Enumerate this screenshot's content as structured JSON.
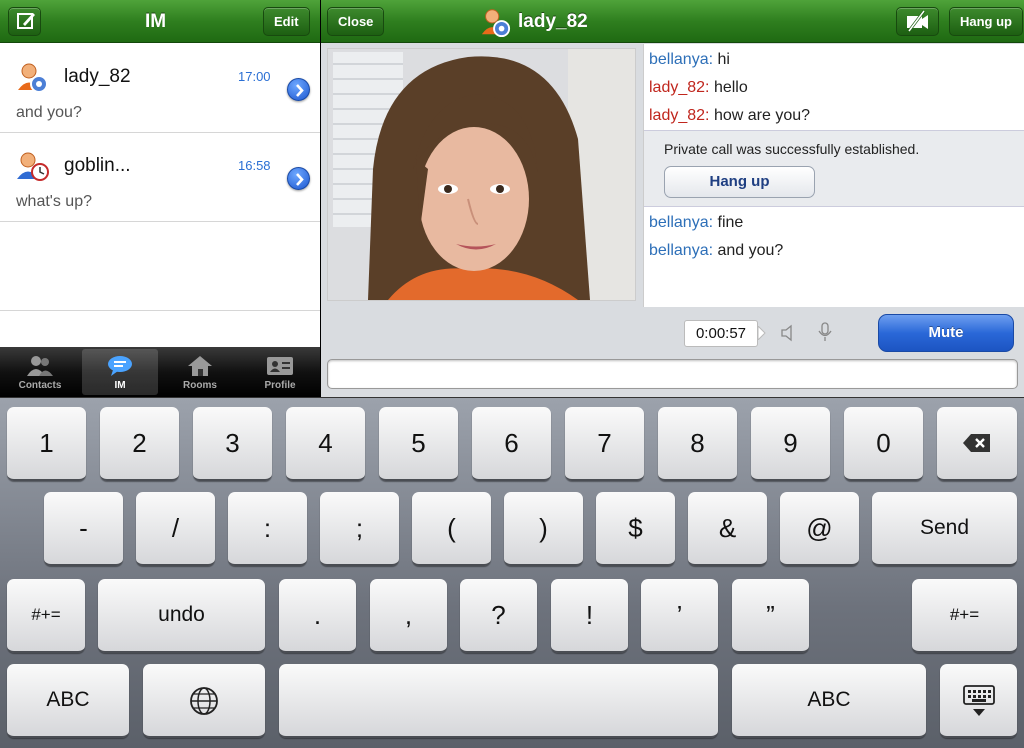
{
  "left_nav": {
    "title": "IM",
    "edit_label": "Edit"
  },
  "conversations": [
    {
      "name": "lady_82",
      "time": "17:00",
      "message": "and you?"
    },
    {
      "name": "goblin...",
      "time": "16:58",
      "message": "what's up?"
    }
  ],
  "tabs": [
    {
      "label": "Contacts",
      "icon": "contacts-icon"
    },
    {
      "label": "IM",
      "icon": "im-bubble-icon",
      "active": true
    },
    {
      "label": "Rooms",
      "icon": "house-icon"
    },
    {
      "label": "Profile",
      "icon": "profile-card-icon"
    }
  ],
  "right_nav": {
    "close_label": "Close",
    "title": "lady_82",
    "hangup_label": "Hang up"
  },
  "chat": {
    "messages_before": [
      {
        "user": "bellanya:",
        "text": " hi",
        "color": "#2d6fb8"
      },
      {
        "user": "lady_82:",
        "text": " hello",
        "color": "#c0261d"
      },
      {
        "user": "lady_82:",
        "text": " how are you?",
        "color": "#c0261d"
      }
    ],
    "notice": "Private call was successfully established.",
    "notice_button": "Hang up",
    "messages_after": [
      {
        "user": "bellanya:",
        "text": " fine",
        "color": "#2d6fb8"
      },
      {
        "user": "bellanya:",
        "text": " and you?",
        "color": "#2d6fb8"
      }
    ]
  },
  "call": {
    "timer": "0:00:57",
    "mute_label": "Mute"
  },
  "input": {
    "value": ""
  },
  "keyboard": {
    "row1": [
      "1",
      "2",
      "3",
      "4",
      "5",
      "6",
      "7",
      "8",
      "9",
      "0"
    ],
    "row2": [
      "-",
      "/",
      ":",
      ";",
      "(",
      ")",
      "$",
      "&",
      "@"
    ],
    "send": "Send",
    "row3_left": "#+=",
    "undo": "undo",
    "row3": [
      ".",
      ",",
      "?",
      "!",
      "’",
      "”"
    ],
    "row3_right": "#+=",
    "abc_left": "ABC",
    "abc_right": "ABC"
  },
  "colors": {
    "nav_green": "#2f7f1f",
    "mute_blue": "#2a68d8",
    "link_blue": "#2d6fb8",
    "user_red": "#c0261d"
  }
}
